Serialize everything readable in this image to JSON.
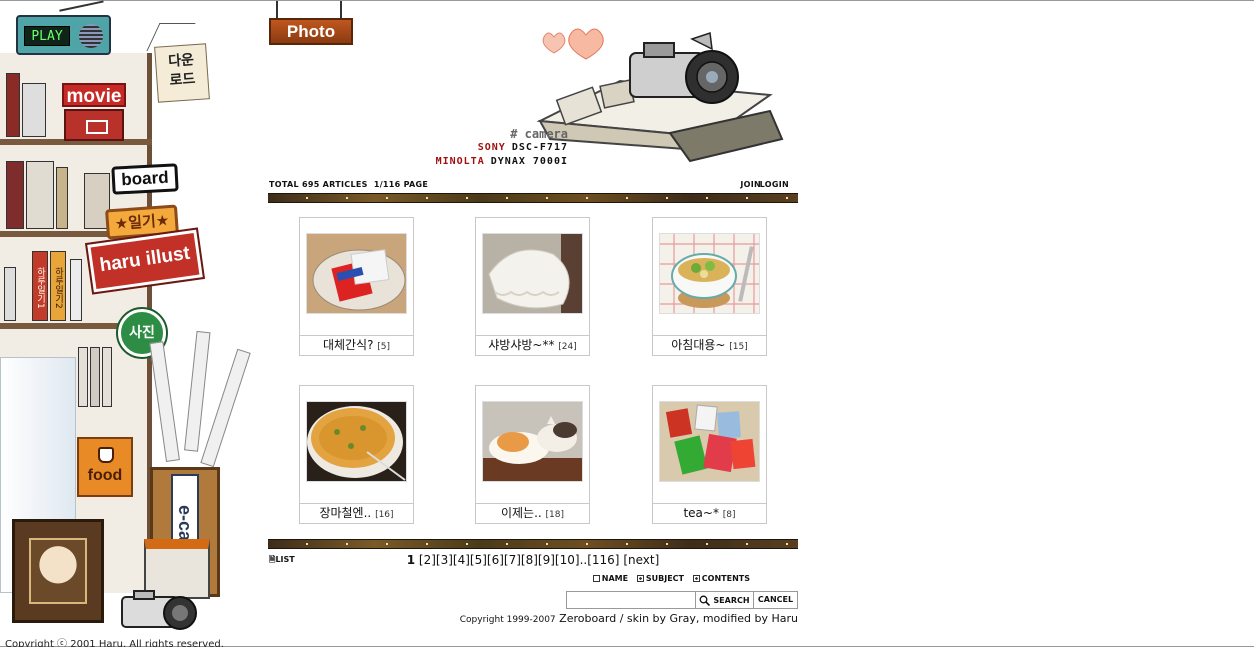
{
  "sidebar": {
    "play_label": "PLAY",
    "download_label": "다운\n로드",
    "movie_label": "movie",
    "board_label": "board",
    "diary_label": "★일기★",
    "illust_label": "haru illust",
    "photo_label": "사진",
    "food_label": "food",
    "ecard_label": "e-card",
    "book_labels": [
      "하루일기1",
      "하루일기2"
    ],
    "copyright": "Copyright ⓒ 2001 Haru. All rights reserved."
  },
  "header": {
    "title": "Photo",
    "camera_title": "# camera",
    "cameras": [
      {
        "brand": "SONY",
        "model": "DSC-F717"
      },
      {
        "brand": "MINOLTA",
        "model": "DYNAX 7000I"
      }
    ]
  },
  "stats": {
    "total": "TOTAL 695 ARTICLES  1/116 PAGE",
    "join": "JOIN",
    "login": "LOGIN"
  },
  "posts": [
    {
      "title": "대체간식?",
      "count": "[5]",
      "thumb": "snack"
    },
    {
      "title": "샤방샤방~**",
      "count": "[24]",
      "thumb": "lace"
    },
    {
      "title": "아침대용~",
      "count": "[15]",
      "thumb": "bowl"
    },
    {
      "title": "장마철엔..",
      "count": "[16]",
      "thumb": "pancake"
    },
    {
      "title": "이제는..",
      "count": "[18]",
      "thumb": "cat"
    },
    {
      "title": "tea~*",
      "count": "[8]",
      "thumb": "tea"
    }
  ],
  "list_label": "LIST",
  "pagination": {
    "current": "1",
    "pages": [
      "[2]",
      "[3]",
      "[4]",
      "[5]",
      "[6]",
      "[7]",
      "[8]",
      "[9]",
      "[10]"
    ],
    "separator": "..",
    "last": "[116]",
    "next": "[next]"
  },
  "search": {
    "options": [
      {
        "label": "NAME",
        "checked": false
      },
      {
        "label": "SUBJECT",
        "checked": true
      },
      {
        "label": "CONTENTS",
        "checked": true
      }
    ],
    "input_value": "",
    "search_label": "SEARCH",
    "cancel_label": "CANCEL"
  },
  "footer": {
    "prefix": "Copyright 1999-2007",
    "credit": " Zeroboard / skin by Gray, modified by Haru"
  },
  "colors": {
    "title_sign": "#a8461a",
    "brand_red": "#a01010",
    "card_border": "#c9c9c9"
  }
}
